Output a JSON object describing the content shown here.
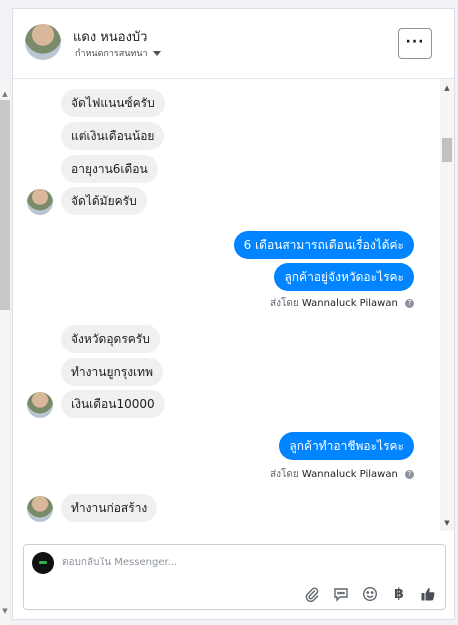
{
  "header": {
    "contact_name": "แดง หนองบัว",
    "status_label": "กำหนดการสนทนา",
    "more_label": "···"
  },
  "messages": [
    {
      "direction": "in",
      "text": "จัดไฟแนนซ์ครับ"
    },
    {
      "direction": "in",
      "text": "แต่เงินเดือนน้อย"
    },
    {
      "direction": "in",
      "text": "อายุงาน6เดือน"
    },
    {
      "direction": "in",
      "text": "จัดได้มัยครับ"
    },
    {
      "direction": "out",
      "text": "6 เดือนสามารถเดือนเรื่องได้ค่ะ"
    },
    {
      "direction": "out",
      "text": "ลูกค้าอยู่จังหวัดอะไรคะ"
    },
    {
      "direction": "in",
      "text": "จังหวัดอุดรครับ"
    },
    {
      "direction": "in",
      "text": "ทำงานยูกรุงเทพ"
    },
    {
      "direction": "in",
      "text": "เงินเดือน10000"
    },
    {
      "direction": "out",
      "text": "ลูกค้าทำอาชีพอะไรคะ"
    },
    {
      "direction": "in",
      "text": "ทำงานก่อสร้าง"
    }
  ],
  "sent_by": [
    {
      "prefix": "ส่งโดย",
      "sender": "Wannaluck Pilawan",
      "info": "?"
    },
    {
      "prefix": "ส่งโดย",
      "sender": "Wannaluck Pilawan",
      "info": "?"
    }
  ],
  "composer": {
    "placeholder": "ตอบกลับใน Messenger...",
    "value": ""
  },
  "toolbar_icons": [
    "attachment-icon",
    "saved-reply-icon",
    "emoji-icon",
    "baht-payment-icon",
    "thumbs-up-icon"
  ],
  "toolbar": {
    "baht_symbol": "฿"
  },
  "colors": {
    "outgoing_bubble": "#0084ff",
    "incoming_bubble": "#f1f0f0"
  }
}
